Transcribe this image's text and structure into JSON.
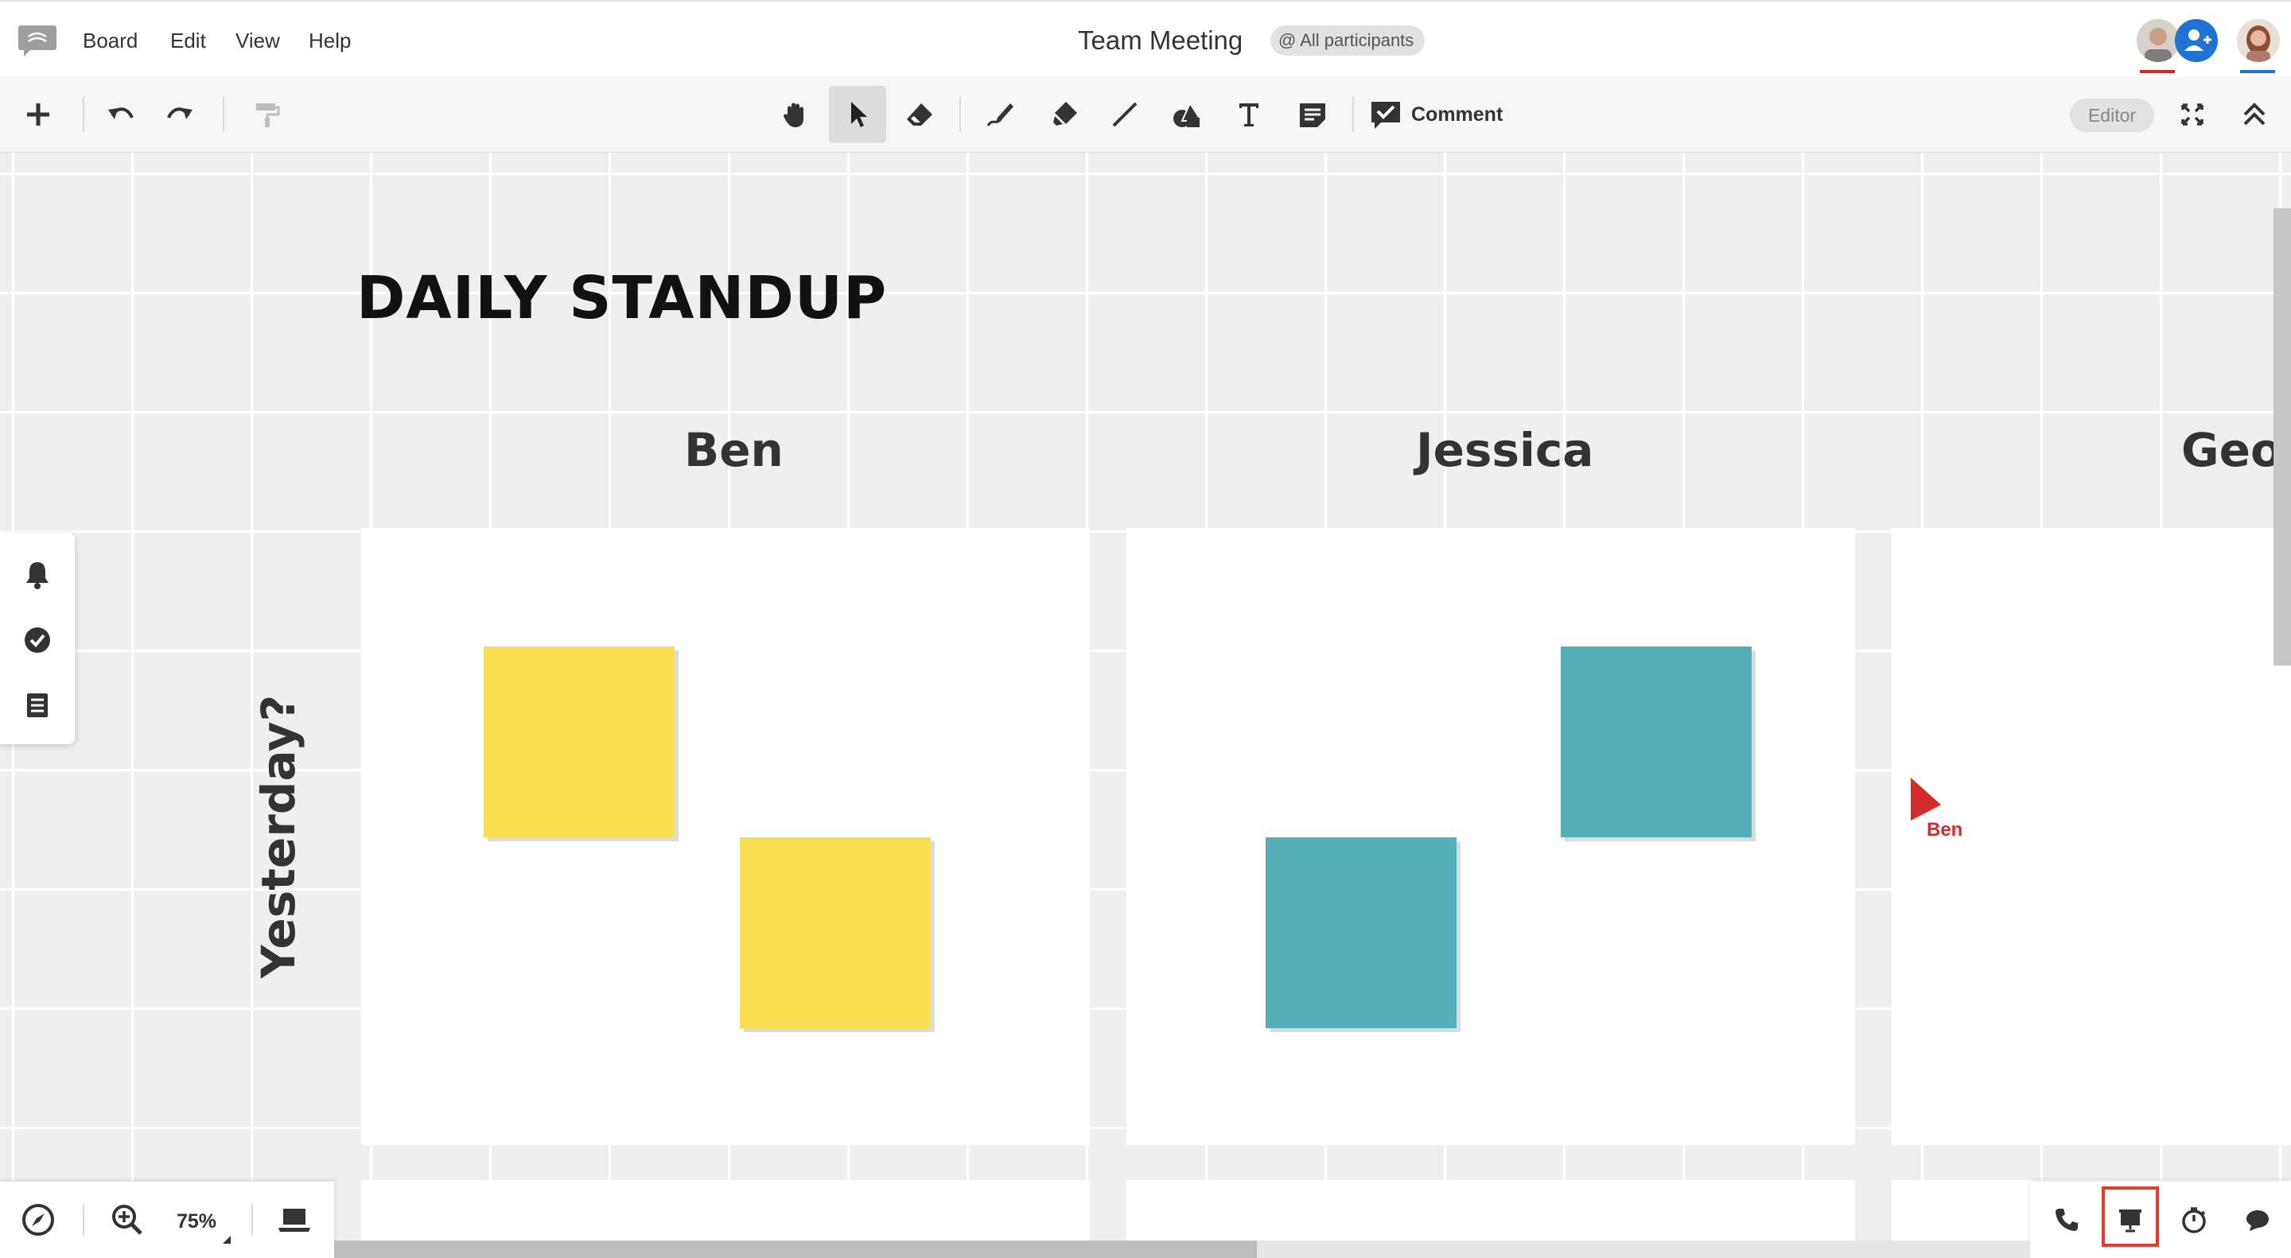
{
  "menubar": {
    "menu_items": [
      "Board",
      "Edit",
      "View",
      "Help"
    ],
    "board_title": "Team Meeting",
    "mention_chip": "@ All participants"
  },
  "toolbar": {
    "tools": [
      "add-icon",
      "undo-icon",
      "redo-icon",
      "format-painter-icon",
      "hand-icon",
      "select-icon",
      "eraser-icon",
      "pen-icon",
      "highlighter-icon",
      "line-icon",
      "shapes-icon",
      "text-icon",
      "sticky-note-icon",
      "comment-icon"
    ],
    "active_tool": "select",
    "comment_label": "Comment",
    "editor_badge": "Editor"
  },
  "canvas": {
    "heading": "DAILY STANDUP",
    "columns": [
      "Ben",
      "Jessica",
      "Geor"
    ],
    "row_header": "Yesterday?",
    "cursor": {
      "name": "Ben",
      "color": "#d12c2c"
    },
    "colors": {
      "yellow_note": "#f8dd4f",
      "teal_note": "#55afb8"
    }
  },
  "side_panel": {
    "buttons": [
      "bell-icon",
      "check-circle-icon",
      "list-icon"
    ]
  },
  "bottom_left": {
    "zoom": "75%",
    "buttons": [
      "compass-icon",
      "zoom-in-icon",
      "laptop-icon"
    ]
  },
  "bottom_right": {
    "buttons": [
      "phone-icon",
      "present-icon",
      "timer-icon",
      "chat-icon"
    ],
    "highlight_color": "#e53a2f"
  }
}
